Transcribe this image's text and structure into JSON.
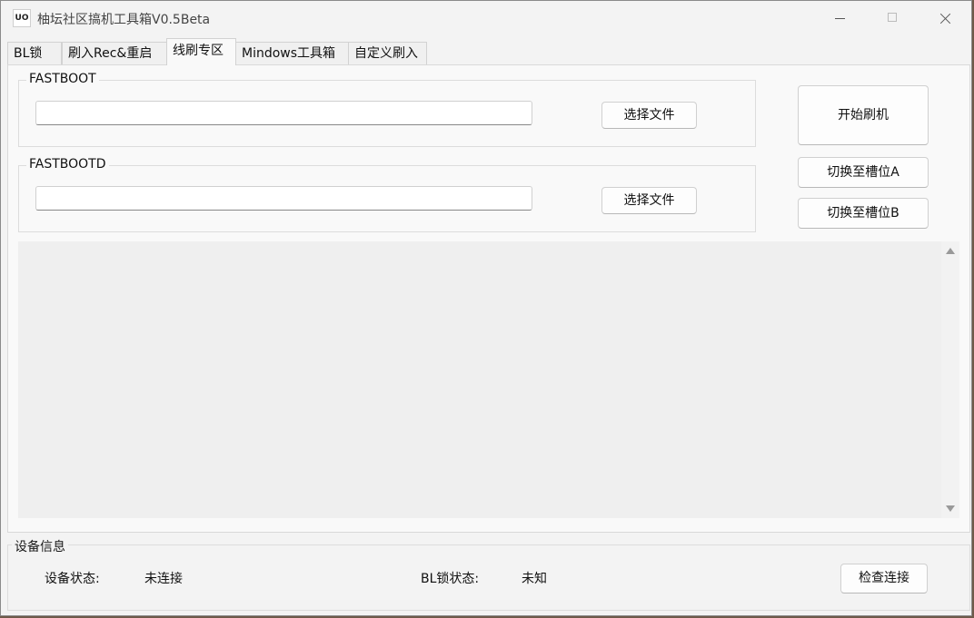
{
  "window": {
    "icon_text": "UO",
    "title": "柚坛社区搞机工具箱V0.5Beta"
  },
  "tabs": [
    {
      "label": "BL锁"
    },
    {
      "label": "刷入Rec&重启"
    },
    {
      "label": "线刷专区",
      "active": true
    },
    {
      "label": "Mindows工具箱"
    },
    {
      "label": "自定义刷入"
    }
  ],
  "fastboot": {
    "title": "FASTBOOT",
    "path_value": "",
    "select_label": "选择文件"
  },
  "fastbootd": {
    "title": "FASTBOOTD",
    "path_value": "",
    "select_label": "选择文件"
  },
  "actions": {
    "flash_label": "开始刷机",
    "slot_a_label": "切换至槽位A",
    "slot_b_label": "切换至槽位B"
  },
  "log": {
    "text": ""
  },
  "device_info": {
    "title": "设备信息",
    "status_label": "设备状态:",
    "status_value": "未连接",
    "bl_label": "BL锁状态:",
    "bl_value": "未知",
    "check_label": "检查连接"
  }
}
